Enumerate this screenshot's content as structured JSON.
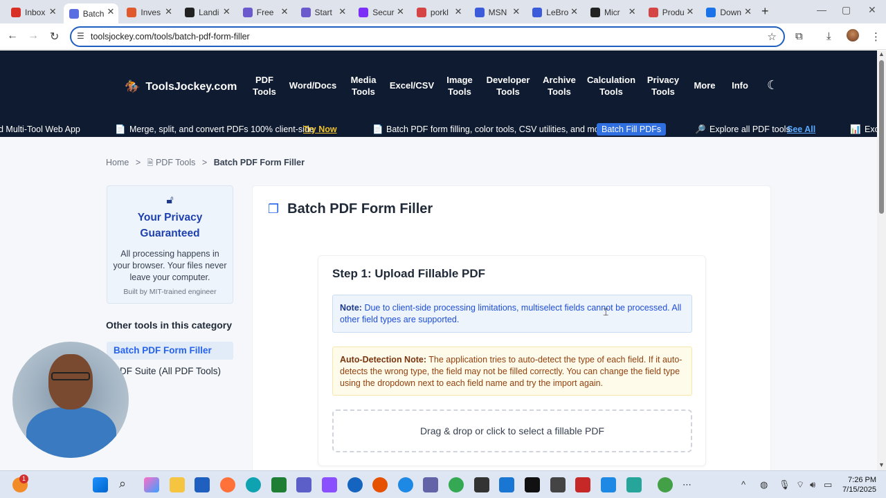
{
  "browser": {
    "tabs": [
      {
        "label": "Inbox",
        "color": "#d93025"
      },
      {
        "label": "Batch",
        "color": "#5b6ee1"
      },
      {
        "label": "Inves",
        "color": "#e05a2b"
      },
      {
        "label": "Landi",
        "color": "#222222"
      },
      {
        "label": "Free",
        "color": "#6a5acd"
      },
      {
        "label": "Start",
        "color": "#6a5acd"
      },
      {
        "label": "Secur",
        "color": "#7b2ff7"
      },
      {
        "label": "porkl",
        "color": "#d64545"
      },
      {
        "label": "MSN",
        "color": "#3b5bdb"
      },
      {
        "label": "LeBro",
        "color": "#3b5bdb"
      },
      {
        "label": "Micr",
        "color": "#222222"
      },
      {
        "label": "Produ",
        "color": "#d64545"
      },
      {
        "label": "Down",
        "color": "#1a73e8"
      }
    ],
    "url": "toolsjockey.com/tools/batch-pdf-form-filler"
  },
  "site": {
    "logo": "ToolsJockey.com",
    "nav": [
      {
        "l1": "PDF",
        "l2": "Tools"
      },
      {
        "l1": "Word/Docs",
        "l2": ""
      },
      {
        "l1": "Media",
        "l2": "Tools"
      },
      {
        "l1": "Excel/CSV",
        "l2": ""
      },
      {
        "l1": "Image",
        "l2": "Tools"
      },
      {
        "l1": "Developer",
        "l2": "Tools"
      },
      {
        "l1": "Archive",
        "l2": "Tools"
      },
      {
        "l1": "Calculation",
        "l2": "Tools"
      },
      {
        "l1": "Privacy",
        "l2": "Tools"
      },
      {
        "l1": "More",
        "l2": ""
      },
      {
        "l1": "Info",
        "l2": ""
      }
    ],
    "ticker": {
      "t0": "d Multi-Tool Web App",
      "t1": "Merge, split, and convert PDFs 100% client-side",
      "t1_link": "Try Now",
      "t2": "Batch PDF form filling, color tools, CSV utilities, and more!",
      "t2_btn": "Batch Fill PDFs",
      "t3": "Explore all PDF tools",
      "t3_link": "See All",
      "t4": "Exc"
    }
  },
  "breadcrumb": {
    "home": "Home",
    "sep": ">",
    "pdf": "PDF Tools",
    "current": "Batch PDF Form Filler"
  },
  "privacy": {
    "title": "Your Privacy Guaranteed",
    "body": "All processing happens in your browser. Your files never leave your computer.",
    "footer": "Built by MIT-trained engineer"
  },
  "other": {
    "title": "Other tools in this category",
    "items": [
      "Batch PDF Form Filler",
      "PDF Suite (All PDF Tools)"
    ]
  },
  "main": {
    "title": "Batch PDF Form Filler",
    "step_title": "Step 1: Upload Fillable PDF",
    "note_label": "Note:",
    "note_text": "Due to client-side processing limitations, multiselect fields cannot be processed. All other field types are supported.",
    "auto_label": "Auto-Detection Note:",
    "auto_text": "The application tries to auto-detect the type of each field. If it auto-detects the wrong type, the field may not be filled correctly. You can change the field type using the dropdown next to each field name and try the import again.",
    "dropzone": "Drag & drop or click to select a fillable PDF"
  },
  "taskbar": {
    "badge": "1",
    "time": "7:26 PM",
    "date": "7/15/2025"
  }
}
